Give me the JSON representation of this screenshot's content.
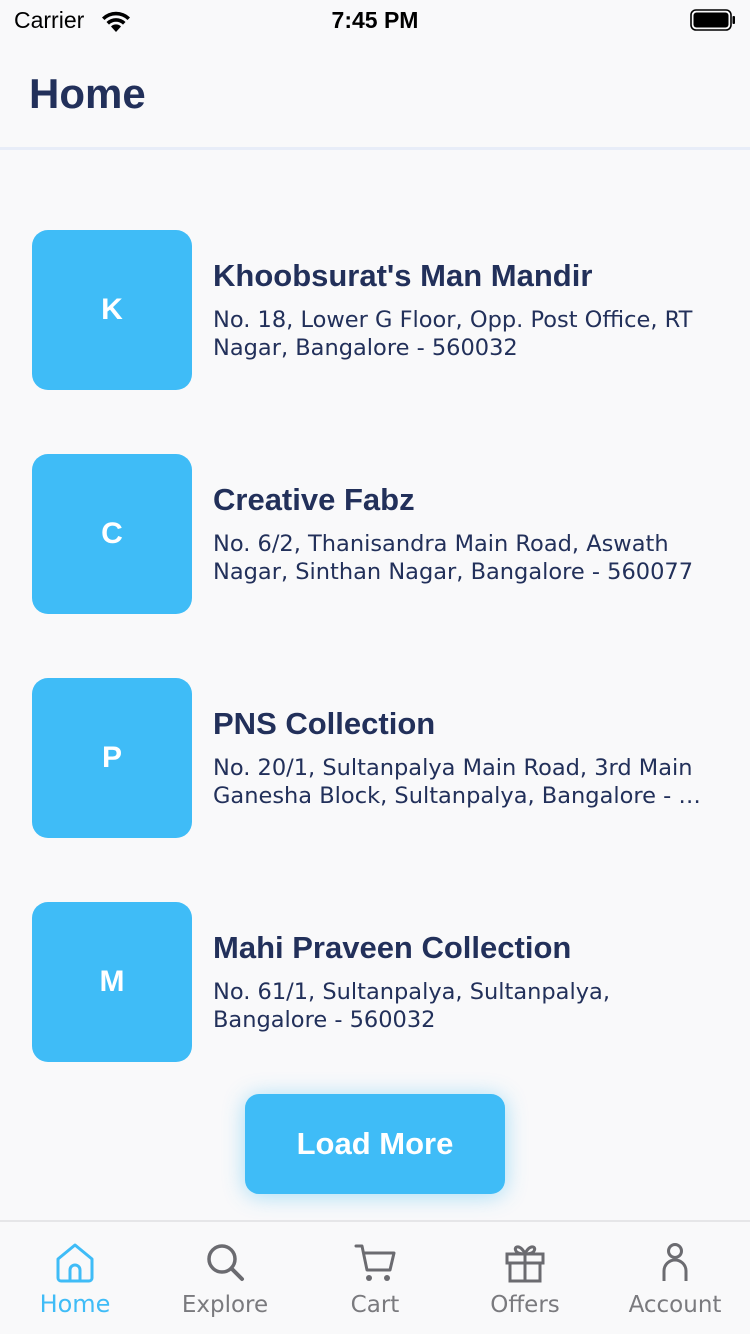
{
  "status_bar": {
    "carrier": "Carrier",
    "time": "7:45 PM"
  },
  "header": {
    "title": "Home"
  },
  "stores": [
    {
      "initial": "K",
      "name": "Khoobsurat's Man Mandir",
      "address": "No. 18, Lower G Floor, Opp. Post Office, RT Nagar, Bangalore - 560032"
    },
    {
      "initial": "C",
      "name": "Creative Fabz",
      "address": "No. 6/2, Thanisandra Main Road, Aswath Nagar, Sinthan Nagar, Bangalore - 560077"
    },
    {
      "initial": "P",
      "name": "PNS Collection",
      "address": "No. 20/1, Sultanpalya Main Road, 3rd Main Ganesha Block, Sultanpalya, Bangalore - …"
    },
    {
      "initial": "M",
      "name": "Mahi Praveen Collection",
      "address": "No. 61/1, Sultanpalya, Sultanpalya, Bangalore - 560032"
    }
  ],
  "load_more_label": "Load More",
  "tabs": [
    {
      "label": "Home",
      "icon": "home-icon",
      "active": true
    },
    {
      "label": "Explore",
      "icon": "search-icon",
      "active": false
    },
    {
      "label": "Cart",
      "icon": "cart-icon",
      "active": false
    },
    {
      "label": "Offers",
      "icon": "gift-icon",
      "active": false
    },
    {
      "label": "Account",
      "icon": "person-icon",
      "active": false
    }
  ],
  "colors": {
    "accent": "#3fbcf7",
    "text_primary": "#22305a",
    "tab_inactive": "#7a7a7e",
    "background": "#f9f9fa"
  }
}
